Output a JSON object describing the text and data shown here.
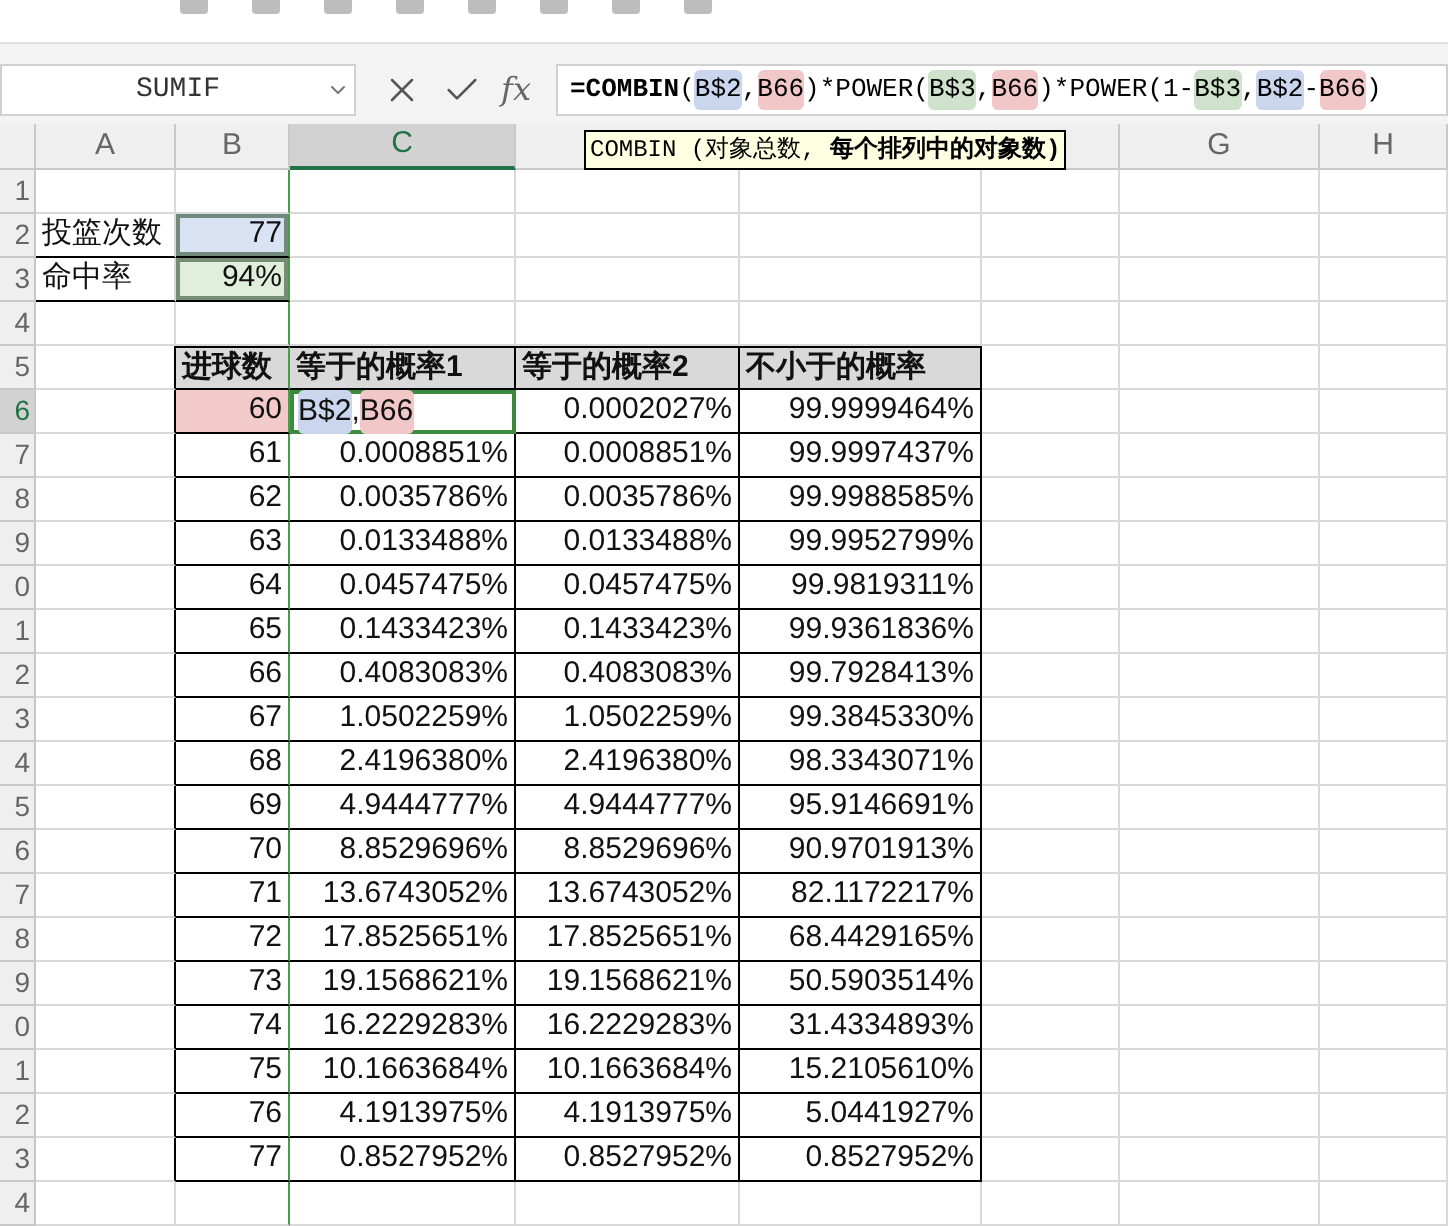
{
  "name_box": {
    "value": "SUMIF"
  },
  "formula_bar": {
    "label": "fx",
    "parts": [
      {
        "text": "=COMBIN",
        "bold": true
      },
      {
        "text": "("
      },
      {
        "text": "B$2",
        "color": "#c9d6ee"
      },
      {
        "text": ","
      },
      {
        "text": "B66",
        "color": "#f2c7c7"
      },
      {
        "text": ")*POWER("
      },
      {
        "text": "B$3",
        "color": "#cfe3cc"
      },
      {
        "text": ","
      },
      {
        "text": "B66",
        "color": "#f2c7c7"
      },
      {
        "text": ")*POWER(1-"
      },
      {
        "text": "B$3",
        "color": "#cfe3cc"
      },
      {
        "text": ","
      },
      {
        "text": "B$2",
        "color": "#c9d6ee"
      },
      {
        "text": "-"
      },
      {
        "text": "B66",
        "color": "#f2c7c7"
      },
      {
        "text": ")"
      }
    ]
  },
  "tooltip": "COMBIN (对象总数, **每个排列中的对象数)**",
  "columns": [
    {
      "label": "A",
      "selected": false
    },
    {
      "label": "B",
      "selected": false
    },
    {
      "label": "C",
      "selected": true
    },
    {
      "label": "G",
      "selected": false
    },
    {
      "label": "H",
      "selected": false
    }
  ],
  "rows": [
    {
      "header": "1",
      "kind": "blank",
      "selected": false
    },
    {
      "header": "2",
      "kind": "input",
      "selected": false,
      "label": "投篮次数",
      "value": "77",
      "color": "#dae3f3"
    },
    {
      "header": "3",
      "kind": "input",
      "selected": false,
      "label": "命中率",
      "value": "94%",
      "color": "#e2eedc"
    },
    {
      "header": "4",
      "kind": "blank",
      "selected": false
    },
    {
      "header": "5",
      "kind": "table_header",
      "selected": false,
      "cells": [
        "进球数",
        "等于的概率1",
        "等于的概率2",
        "不小于的概率"
      ]
    },
    {
      "header": "6",
      "kind": "editing",
      "selected": true,
      "value": "60",
      "color": "#f2caca",
      "parts": [
        {
          "text": "B$2",
          "color": "#c9d6ee"
        },
        {
          "text": ", "
        },
        {
          "text": "B66",
          "color": "#f2c7c7"
        }
      ],
      "cells": [
        "0.0002027%",
        "99.9999464%"
      ]
    },
    {
      "header": "7",
      "kind": "data",
      "selected": false,
      "cells": [
        "61",
        "0.0008851%",
        "0.0008851%",
        "99.9997437%"
      ]
    },
    {
      "header": "8",
      "kind": "data",
      "selected": false,
      "cells": [
        "62",
        "0.0035786%",
        "0.0035786%",
        "99.9988585%"
      ]
    },
    {
      "header": "9",
      "kind": "data",
      "selected": false,
      "cells": [
        "63",
        "0.0133488%",
        "0.0133488%",
        "99.9952799%"
      ]
    },
    {
      "header": "0",
      "kind": "data",
      "selected": false,
      "cells": [
        "64",
        "0.0457475%",
        "0.0457475%",
        "99.9819311%"
      ]
    },
    {
      "header": "1",
      "kind": "data",
      "selected": false,
      "cells": [
        "65",
        "0.1433423%",
        "0.1433423%",
        "99.9361836%"
      ]
    },
    {
      "header": "2",
      "kind": "data",
      "selected": false,
      "cells": [
        "66",
        "0.4083083%",
        "0.4083083%",
        "99.7928413%"
      ]
    },
    {
      "header": "3",
      "kind": "data",
      "selected": false,
      "cells": [
        "67",
        "1.0502259%",
        "1.0502259%",
        "99.3845330%"
      ]
    },
    {
      "header": "4",
      "kind": "data",
      "selected": false,
      "cells": [
        "68",
        "2.4196380%",
        "2.4196380%",
        "98.3343071%"
      ]
    },
    {
      "header": "5",
      "kind": "data",
      "selected": false,
      "cells": [
        "69",
        "4.9444777%",
        "4.9444777%",
        "95.9146691%"
      ]
    },
    {
      "header": "6",
      "kind": "data",
      "selected": false,
      "cells": [
        "70",
        "8.8529696%",
        "8.8529696%",
        "90.9701913%"
      ]
    },
    {
      "header": "7",
      "kind": "data",
      "selected": false,
      "cells": [
        "71",
        "13.6743052%",
        "13.6743052%",
        "82.1172217%"
      ]
    },
    {
      "header": "8",
      "kind": "data",
      "selected": false,
      "cells": [
        "72",
        "17.8525651%",
        "17.8525651%",
        "68.4429165%"
      ]
    },
    {
      "header": "9",
      "kind": "data",
      "selected": false,
      "cells": [
        "73",
        "19.1568621%",
        "19.1568621%",
        "50.5903514%"
      ]
    },
    {
      "header": "0",
      "kind": "data",
      "selected": false,
      "cells": [
        "74",
        "16.2229283%",
        "16.2229283%",
        "31.4334893%"
      ]
    },
    {
      "header": "1",
      "kind": "data",
      "selected": false,
      "cells": [
        "75",
        "10.1663684%",
        "10.1663684%",
        "15.2105610%"
      ]
    },
    {
      "header": "2",
      "kind": "data",
      "selected": false,
      "cells": [
        "76",
        "4.1913975%",
        "4.1913975%",
        "5.0441927%"
      ]
    },
    {
      "header": "3",
      "kind": "data",
      "selected": false,
      "cells": [
        "77",
        "0.8527952%",
        "0.8527952%",
        "0.8527952%"
      ]
    },
    {
      "header": "4",
      "kind": "blank",
      "selected": false
    }
  ]
}
